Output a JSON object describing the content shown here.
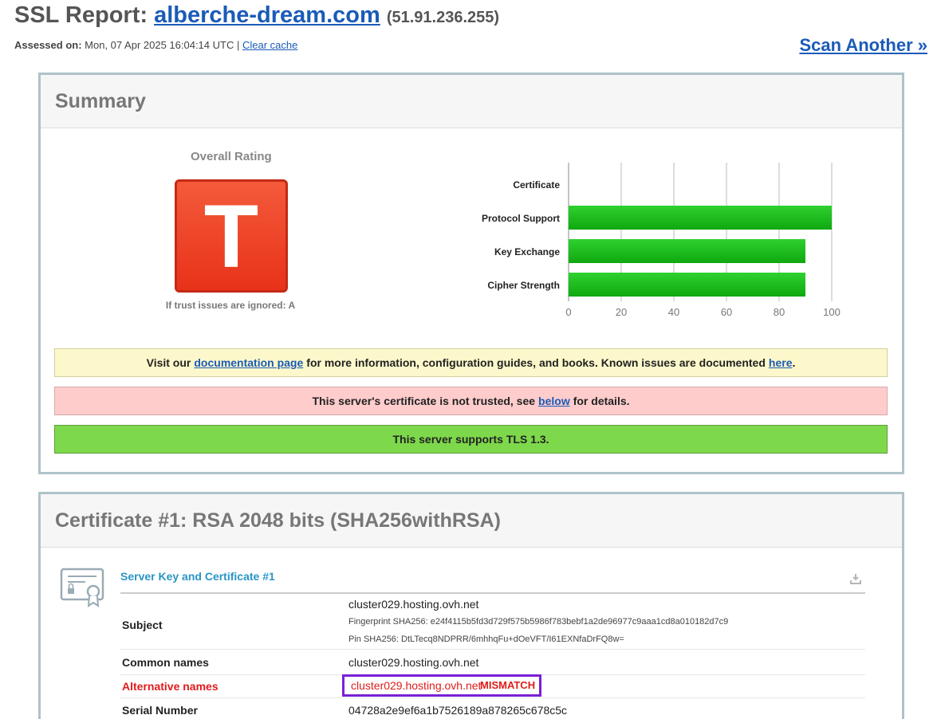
{
  "header": {
    "title_prefix": "SSL Report:",
    "domain": "alberche-dream.com",
    "ip": "(51.91.236.255)",
    "assessed_label": "Assessed on:",
    "assessed_value": "Mon, 07 Apr 2025 16:04:14 UTC |",
    "clear_cache": "Clear cache",
    "scan_another": "Scan Another »"
  },
  "summary": {
    "title": "Summary",
    "overall_label": "Overall Rating",
    "grade": "T",
    "ignored_note": "If trust issues are ignored: A",
    "chart_data": {
      "type": "bar",
      "orientation": "horizontal",
      "categories": [
        "Certificate",
        "Protocol Support",
        "Key Exchange",
        "Cipher Strength"
      ],
      "values": [
        0,
        100,
        90,
        90
      ],
      "xlim": [
        0,
        100
      ],
      "ticks": [
        0,
        20,
        40,
        60,
        80,
        100
      ],
      "grid": true,
      "bar_color": "#19b719"
    },
    "notices": {
      "yellow": {
        "pre": "Visit our",
        "link1": "documentation page",
        "mid": "for more information, configuration guides, and books. Known issues are documented",
        "link2": "here",
        "post": "."
      },
      "red": {
        "pre": "This server's certificate is not trusted, see",
        "link": "below",
        "post": "for details."
      },
      "green": {
        "text": "This server supports TLS 1.3."
      }
    }
  },
  "certificate": {
    "title": "Certificate #1: RSA 2048 bits (SHA256withRSA)",
    "section_title": "Server Key and Certificate #1",
    "rows": {
      "subject": {
        "label": "Subject",
        "value": "cluster029.hosting.ovh.net",
        "fingerprint": "Fingerprint SHA256: e24f4115b5fd3d729f575b5986f783bebf1a2de96977c9aaa1cd8a010182d7c9",
        "pin": "Pin SHA256: DtLTecq8NDPRR/6mhhqFu+dOeVFT/I61EXNfaDrFQ8w="
      },
      "common_names": {
        "label": "Common names",
        "value": "cluster029.hosting.ovh.net"
      },
      "alternative_names": {
        "label": "Alternative names",
        "value": "cluster029.hosting.ovh.net",
        "flag": "MISMATCH"
      },
      "serial": {
        "label": "Serial Number",
        "value": "04728a2e9ef6a1b7526189a878265c678c5c"
      }
    }
  },
  "colors": {
    "link": "#1a5bb8",
    "grade_bg": "#e8321a",
    "warning_red": "#e01b1b",
    "highlight_outline": "#7a1fd6",
    "section_title": "#2a95c6"
  }
}
